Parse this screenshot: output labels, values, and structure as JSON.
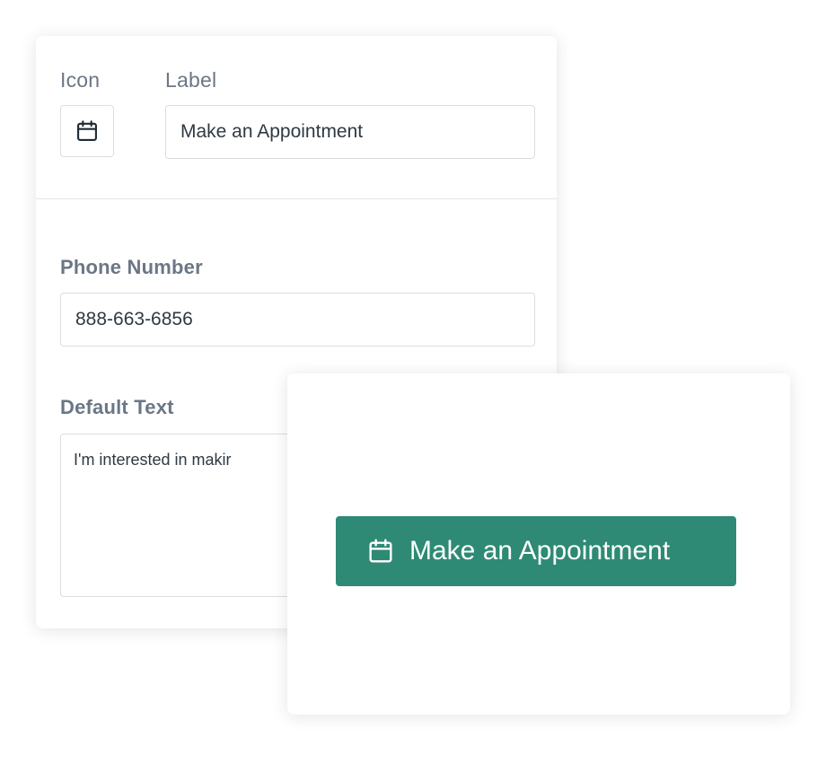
{
  "settings": {
    "icon_label": "Icon",
    "icon": "calendar-icon",
    "label_heading": "Label",
    "label_value": "Make an Appointment",
    "phone_heading": "Phone Number",
    "phone_value": "888-663-6856",
    "default_text_heading": "Default Text",
    "default_text_value": "I'm interested in makir"
  },
  "preview": {
    "button_label": "Make an Appointment",
    "button_icon": "calendar-icon",
    "button_color": "#2e8a74"
  }
}
